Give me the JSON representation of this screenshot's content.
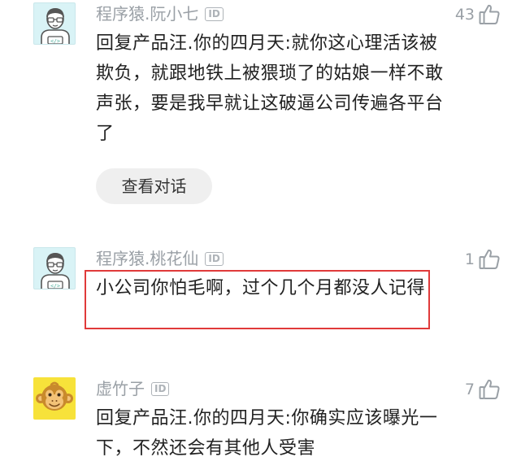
{
  "comments": [
    {
      "username": "程序猿.阮小七",
      "id_badge": "ID",
      "likes": "43",
      "text": "回复产品汪.你的四月天:就你这心理活该被欺负，就跟地铁上被猥琐了的姑娘一样不敢声张，要是我早就让这破逼公司传遍各平台了",
      "view_conversation": "查看对话",
      "avatar": "coder-avatar"
    },
    {
      "username": "程序猿.桃花仙",
      "id_badge": "ID",
      "likes": "1",
      "text": "小公司你怕毛啊，过个几个月都没人记得",
      "avatar": "coder-avatar",
      "highlight_color": "#e03a3a"
    },
    {
      "username": "虚竹子",
      "id_badge": "ID",
      "likes": "7",
      "text": "回复产品汪.你的四月天:你确实应该曝光一下，不然还会有其他人受害",
      "avatar": "monkey-avatar"
    }
  ],
  "colors": {
    "username": "#9aa0a6",
    "text": "#222222",
    "button_bg": "#efefef",
    "highlight": "#e03a3a"
  }
}
